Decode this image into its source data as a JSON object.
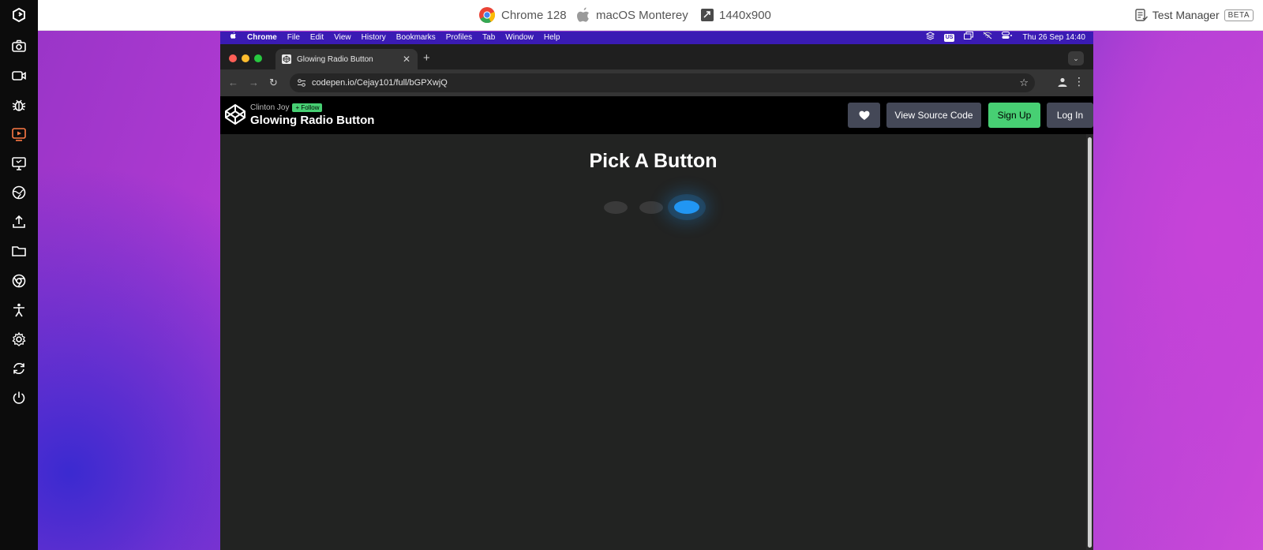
{
  "info_bar": {
    "browser": "Chrome 128",
    "os": "macOS Monterey",
    "resolution": "1440x900",
    "test_manager": "Test Manager",
    "beta": "BETA"
  },
  "sidebar_tools": [
    "logo-icon",
    "camera-icon",
    "video-icon",
    "bug-icon",
    "screen-record-icon",
    "monitor-icon",
    "globe-icon",
    "upload-icon",
    "folder-icon",
    "chrome-icon",
    "accessibility-icon",
    "settings-icon",
    "sync-icon",
    "power-icon"
  ],
  "menubar": {
    "app": "Chrome",
    "items": [
      "File",
      "Edit",
      "View",
      "History",
      "Bookmarks",
      "Profiles",
      "Tab",
      "Window",
      "Help"
    ],
    "input": "US",
    "datetime": "Thu 26 Sep  14:40"
  },
  "browser": {
    "tab_title": "Glowing Radio Button",
    "url": "codepen.io/Cejay101/full/bGPXwjQ"
  },
  "codepen": {
    "author": "Clinton Joy",
    "follow": "+ Follow",
    "pen_title": "Glowing Radio Button",
    "view_source": "View Source Code",
    "sign_up": "Sign Up",
    "log_in": "Log In"
  },
  "page": {
    "heading": "Pick A Button",
    "radio_count": 3,
    "selected_index": 3
  },
  "colors": {
    "accent_green": "#47cf73",
    "radio_on": "#2196f3",
    "menubar": "#3a1bb4"
  }
}
